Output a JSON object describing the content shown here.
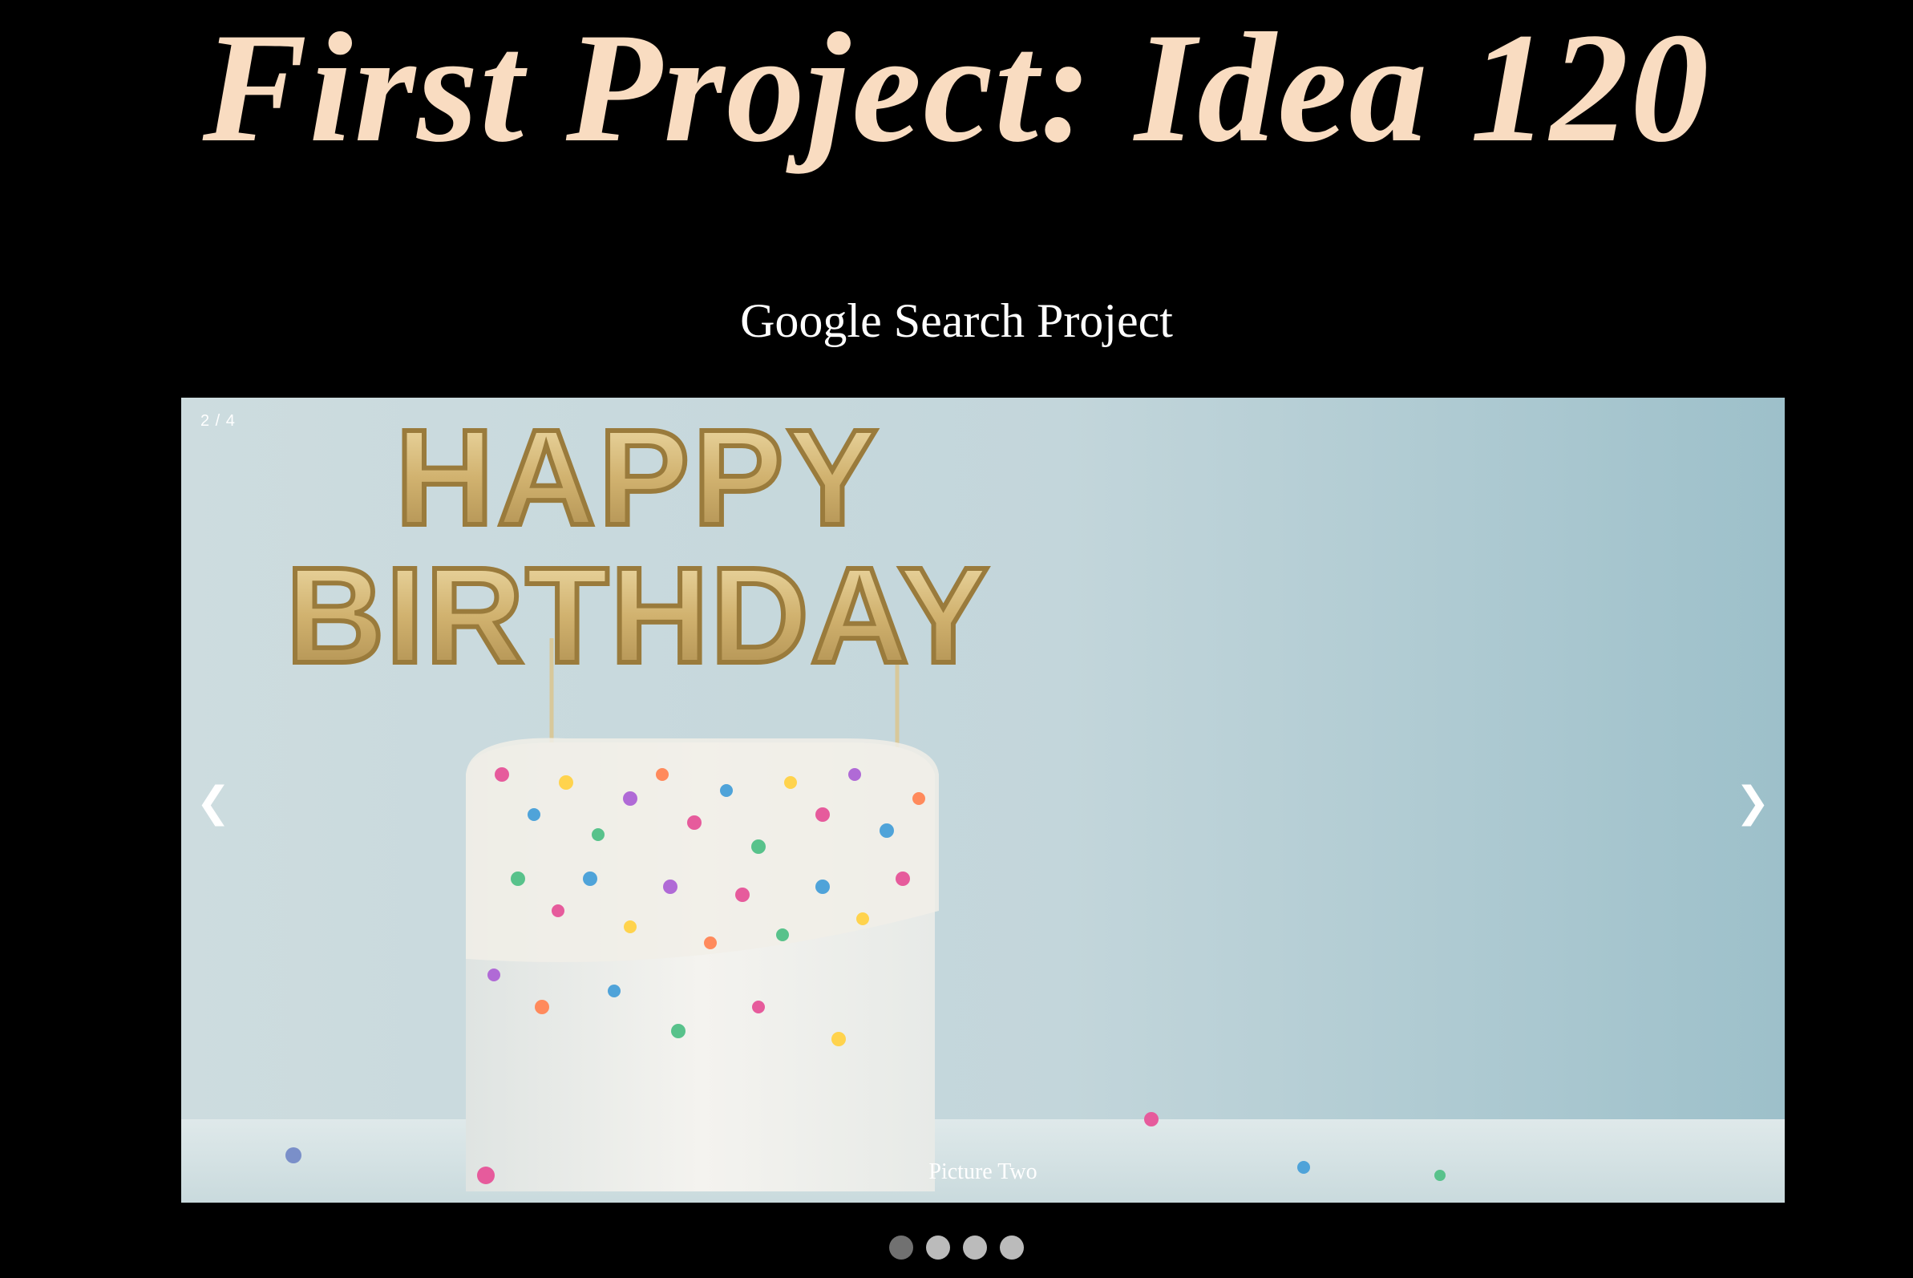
{
  "header": {
    "title": "First Project: Idea 120",
    "subtitle": "Google Search Project"
  },
  "slideshow": {
    "counter": "2 / 4",
    "caption": "Picture Two",
    "prev_label": "❮",
    "next_label": "❯",
    "topper_text_line1": "HAPPY",
    "topper_text_line2": "BIRTHDAY",
    "total_slides": 4,
    "active_index": 1
  },
  "colors": {
    "title": "#f9dcc1",
    "background": "#000000",
    "dot_active": "#717171",
    "dot_inactive": "#bbbbbb"
  }
}
